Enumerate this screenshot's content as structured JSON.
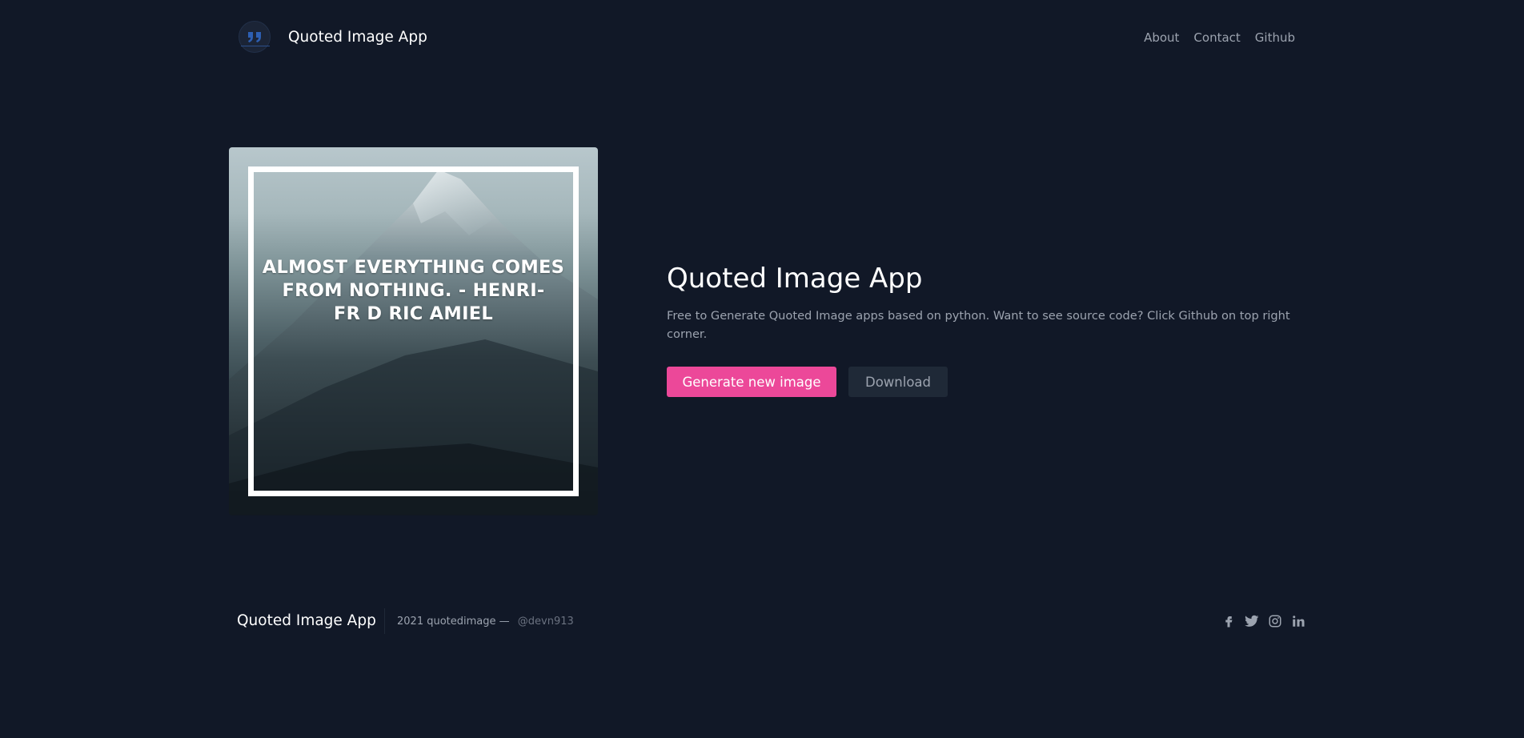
{
  "header": {
    "brand": "Quoted Image App",
    "nav": [
      {
        "label": "About"
      },
      {
        "label": "Contact"
      },
      {
        "label": "Github"
      }
    ],
    "logo_icon": "quote-marks-icon"
  },
  "hero": {
    "image": {
      "quote_lines": [
        "ALMOST EVERYTHING COMES",
        "FROM NOTHING. - HENRI-",
        "FR D RIC AMIEL"
      ],
      "background": "snowy-mountain-photo"
    },
    "title": "Quoted Image App",
    "description": "Free to Generate Quoted Image apps based on python. Want to see source code? Click Github on top right corner.",
    "primary_button": "Generate new image",
    "secondary_button": "Download"
  },
  "footer": {
    "brand": "Quoted Image App",
    "copyright": "2021 quotedimage —",
    "handle": "@devn913",
    "social_icons": [
      "facebook-icon",
      "twitter-icon",
      "instagram-icon",
      "linkedin-icon"
    ]
  },
  "colors": {
    "background": "#111827",
    "accent": "#ec4899",
    "secondary_button": "#1f2937",
    "muted_text": "#9ca3af"
  }
}
